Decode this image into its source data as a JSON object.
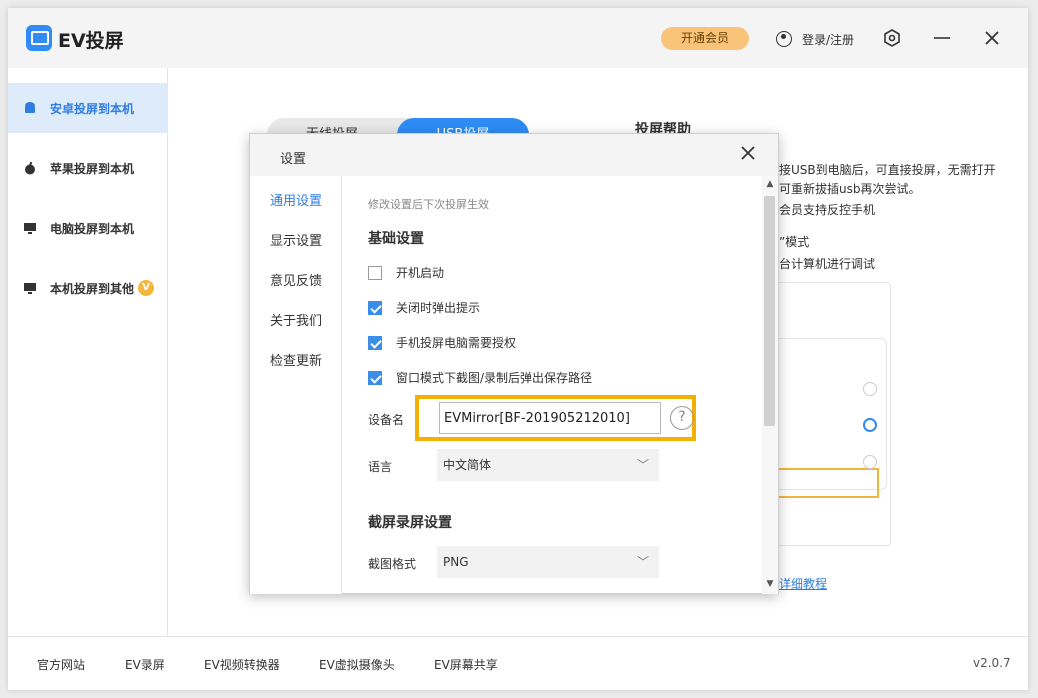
{
  "app": {
    "title": "EV投屏",
    "vip_label": "开通会员",
    "login_label": "登录/注册",
    "settings_icon": "hexagon-settings-icon",
    "minimize_icon": "minimize-icon",
    "close_icon": "close-icon"
  },
  "sidebar": {
    "items": [
      {
        "label": "安卓投屏到本机",
        "icon": "android-icon",
        "active": true
      },
      {
        "label": "苹果投屏到本机",
        "icon": "apple-icon"
      },
      {
        "label": "电脑投屏到本机",
        "icon": "pc-cast-icon"
      },
      {
        "label": "本机投屏到其他",
        "icon": "screen-out-icon",
        "badge": "V"
      }
    ]
  },
  "main": {
    "tabs": [
      {
        "label": "无线投屏"
      },
      {
        "label": "USB投屏",
        "active": true
      }
    ],
    "help_title": "投屏帮助",
    "help_lines": [
      "接USB到电脑后，可直接投屏，无需打开",
      "可重新拔插usb再次尝试。",
      "会员支持反控手机",
      "”模式",
      "台计算机进行调试"
    ],
    "tutorial_link": "详细教程"
  },
  "dialog": {
    "title": "设置",
    "nav": [
      {
        "label": "通用设置",
        "active": true
      },
      {
        "label": "显示设置"
      },
      {
        "label": "意见反馈"
      },
      {
        "label": "关于我们"
      },
      {
        "label": "检查更新"
      }
    ],
    "hint": "修改设置后下次投屏生效",
    "basic_title": "基础设置",
    "checkboxes": [
      {
        "label": "开机启动",
        "checked": false
      },
      {
        "label": "关闭时弹出提示",
        "checked": true
      },
      {
        "label": "手机投屏电脑需要授权",
        "checked": true
      },
      {
        "label": "窗口模式下截图/录制后弹出保存路径",
        "checked": true
      }
    ],
    "device_name_label": "设备名",
    "device_name_value": "EVMirror[BF-201905212010]",
    "help_mark": "?",
    "language_label": "语言",
    "language_value": "中文简体",
    "capture_title": "截屏录屏设置",
    "format_label": "截图格式",
    "format_value": "PNG"
  },
  "footer": {
    "links": [
      "官方网站",
      "EV录屏",
      "EV视频转换器",
      "EV虚拟摄像头",
      "EV屏幕共享"
    ],
    "version": "v2.0.7"
  },
  "colors": {
    "accent": "#2f8cf5",
    "highlight": "#f4b000",
    "vip": "#f9c47a"
  }
}
